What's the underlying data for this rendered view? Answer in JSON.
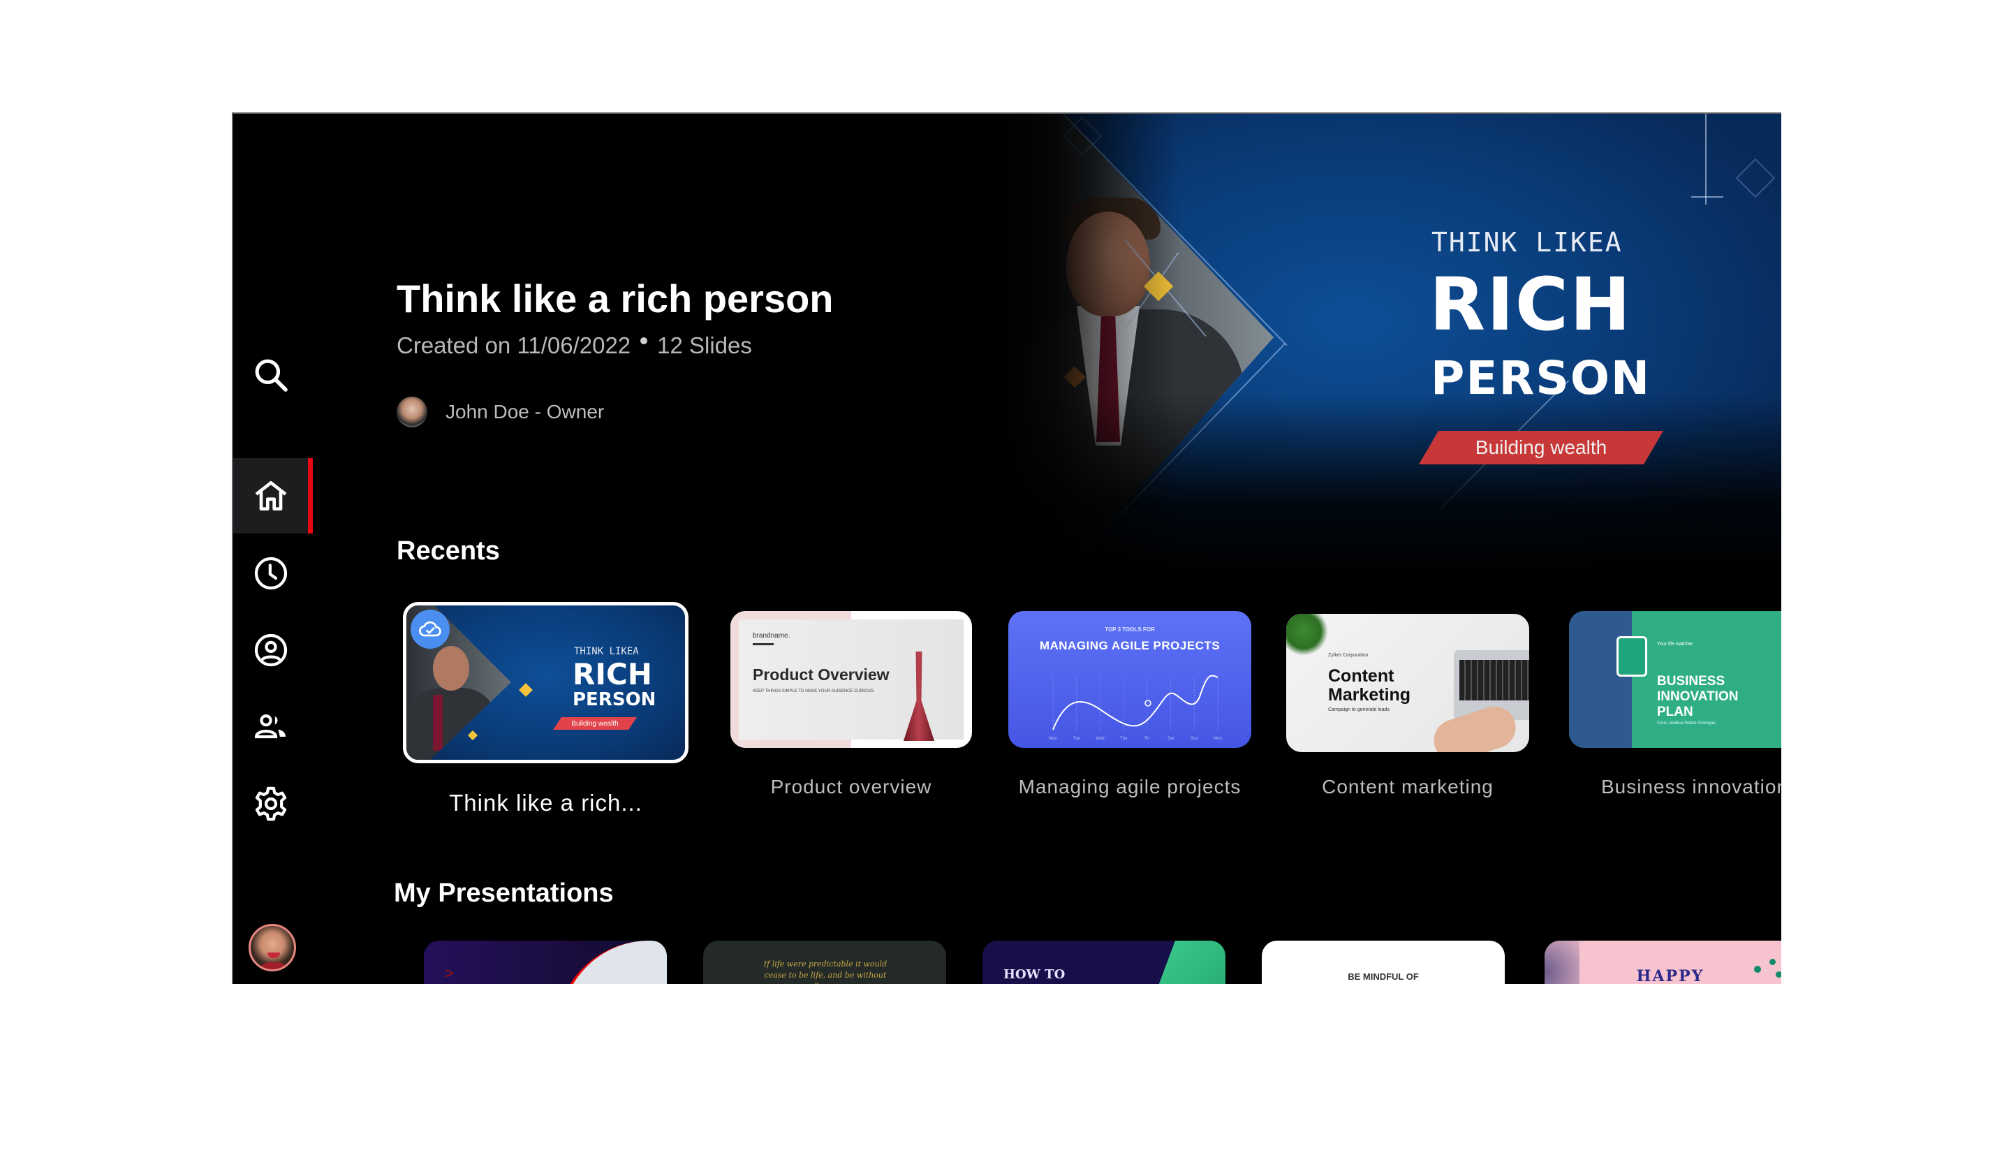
{
  "hero": {
    "title": "Think like a rich person",
    "created": "Created on 11/06/2022",
    "slides": "12 Slides",
    "owner": "John Doe - Owner",
    "preview": {
      "line1": "THINK LIKEA",
      "line2": "RICH",
      "line3": "PERSON",
      "ribbon": "Building wealth"
    }
  },
  "sidebar": {
    "items": [
      {
        "name": "search",
        "label": "Search"
      },
      {
        "name": "home",
        "label": "Home",
        "active": true
      },
      {
        "name": "recent",
        "label": "Recent"
      },
      {
        "name": "profile",
        "label": "Profile"
      },
      {
        "name": "shared",
        "label": "Shared"
      },
      {
        "name": "settings",
        "label": "Settings"
      }
    ],
    "active_color": "#e50914"
  },
  "recents": {
    "heading": "Recents",
    "items": [
      {
        "label": "Think like a rich...",
        "selected": true,
        "synced": true,
        "thumb": {
          "line1": "THINK LIKEA",
          "line2": "RICH",
          "line3": "PERSON",
          "ribbon": "Building wealth"
        }
      },
      {
        "label": "Product overview",
        "thumb": {
          "brand": "brandname.",
          "title": "Product Overview",
          "subtitle": "KEEP THINGS SIMPLE TO MAKE YOUR AUDIENCE CURIOUS."
        }
      },
      {
        "label": "Managing agile projects",
        "thumb": {
          "kicker": "TOP 3 TOOLS FOR",
          "title": "MANAGING AGILE PROJECTS",
          "days": [
            "Mon",
            "Tue",
            "Wed",
            "Thu",
            "Fri",
            "Sat",
            "Sun",
            "Mon"
          ]
        }
      },
      {
        "label": "Content marketing",
        "thumb": {
          "company": "Zylker Corporation",
          "title1": "Content",
          "title2": "Marketing",
          "subtitle": "Campaign to generate leads"
        }
      },
      {
        "label": "Business innovation",
        "thumb": {
          "tag": "Coris",
          "kicker": "Your life watcher",
          "title1": "BUSINESS",
          "title2": "INNOVATION",
          "title3": "PLAN",
          "subtitle": "Coris, Medical Watch Prototype"
        }
      }
    ]
  },
  "presentations": {
    "heading": "My Presentations",
    "items": [
      {
        "thumb_text": ">"
      },
      {
        "thumb_text": "If life were predictable it would cease to be life, and be without flavor."
      },
      {
        "thumb_text": "HOW TO"
      },
      {
        "thumb_text": "BE MINDFUL OF"
      },
      {
        "thumb_text": "HAPPY"
      }
    ]
  }
}
